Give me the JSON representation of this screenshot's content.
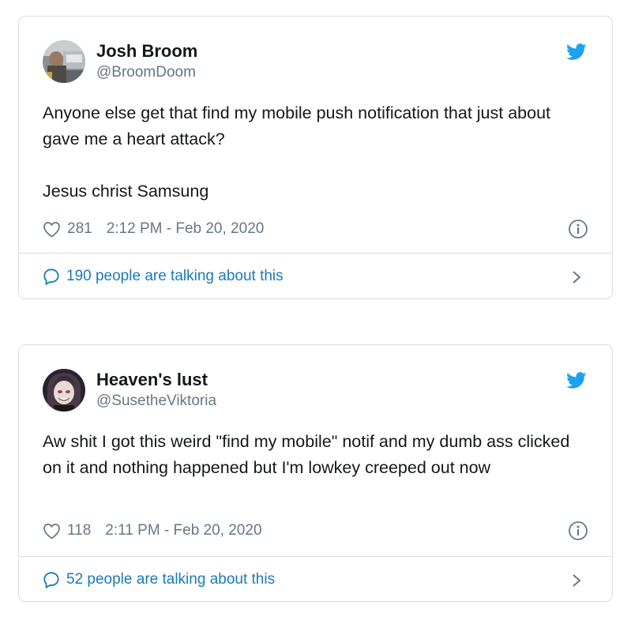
{
  "tweets": [
    {
      "display_name": "Josh Broom",
      "handle": "@BroomDoom",
      "paragraphs": [
        "Anyone else get that find my mobile push notification that just about gave me a heart attack?",
        "Jesus christ Samsung"
      ],
      "likes": "281",
      "timestamp": "2:12 PM - Feb 20, 2020",
      "talking": "190 people are talking about this",
      "avatar_icon": "photo-avatar"
    },
    {
      "display_name": "Heaven's lust",
      "handle": "@SusetheViktoria",
      "paragraphs": [
        "Aw shit I got this weird \"find my mobile\" notif and my dumb ass clicked on it and nothing happened but I'm lowkey creeped out now"
      ],
      "likes": "118",
      "timestamp": "2:11 PM - Feb 20, 2020",
      "talking": "52 people are talking about this",
      "avatar_icon": "anime-avatar"
    }
  ],
  "icons": {
    "brand": "twitter-bird-icon",
    "like": "heart-icon",
    "info": "info-icon",
    "reply": "speech-bubble-icon",
    "more": "chevron-right-icon"
  },
  "colors": {
    "twitter_blue": "#1da1f2",
    "link_blue": "#1b7ab5",
    "secondary_text": "#657786",
    "primary_text": "#14171a",
    "border": "#d9dde1"
  }
}
